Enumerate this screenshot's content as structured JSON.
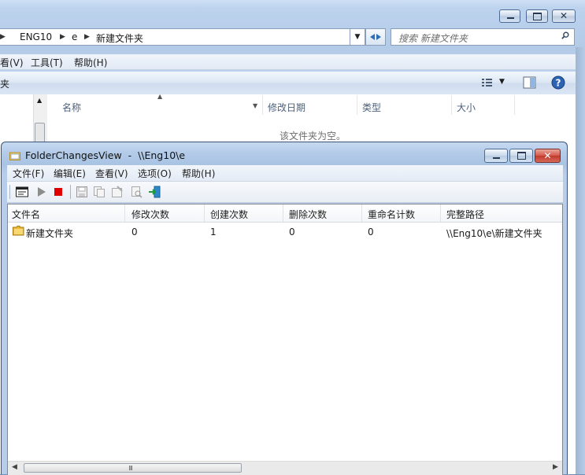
{
  "explorer": {
    "breadcrumbs": [
      "ENG10",
      "e",
      "新建文件夹"
    ],
    "search_placeholder": "搜索 新建文件夹",
    "menu": {
      "view": "看(V)",
      "tools": "工具(T)",
      "help": "帮助(H)"
    },
    "command_label": "夹",
    "columns": {
      "name": "名称",
      "modified": "修改日期",
      "type": "类型",
      "size": "大小"
    },
    "empty_message": "该文件夹为空。"
  },
  "fcv": {
    "title": "FolderChangesView  -  \\\\Eng10\\e",
    "menu": {
      "file": "文件(F)",
      "edit": "编辑(E)",
      "view": "查看(V)",
      "options": "选项(O)",
      "help": "帮助(H)"
    },
    "columns": {
      "filename": "文件名",
      "modify_count": "修改次数",
      "create_count": "创建次数",
      "delete_count": "删除次数",
      "rename_count": "重命名计数",
      "full_path": "完整路径"
    },
    "rows": [
      {
        "filename": "新建文件夹",
        "modify_count": "0",
        "create_count": "1",
        "delete_count": "0",
        "rename_count": "0",
        "full_path": "\\\\Eng10\\e\\新建文件夹"
      }
    ],
    "scroll_grip": "III"
  },
  "colors": {
    "title_bar": "#b3cbe8",
    "close_red": "#c8423a",
    "stop_red": "#e00000",
    "play_gray": "#8c8c8c"
  }
}
